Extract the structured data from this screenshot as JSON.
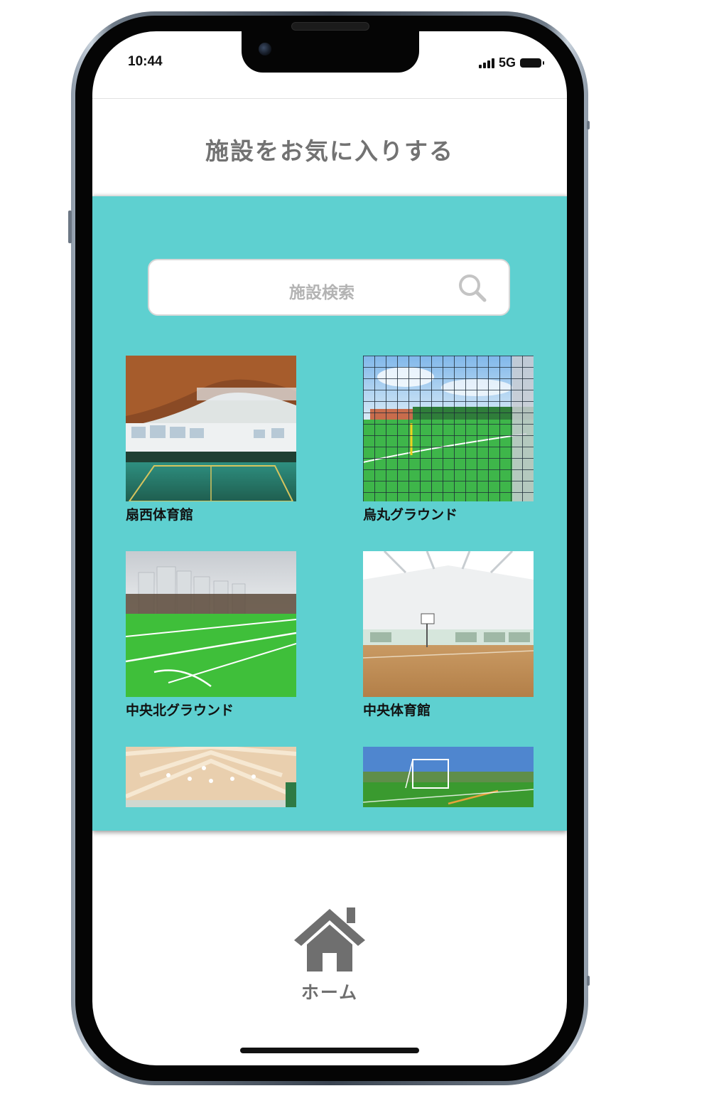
{
  "status_bar": {
    "time": "10:44",
    "network": "5G",
    "icons": [
      "signal-icon",
      "battery-icon"
    ]
  },
  "header": {
    "title": "施設をお気に入りする"
  },
  "search": {
    "placeholder": "施設検索",
    "icon": "search-icon"
  },
  "facilities": [
    {
      "name": "扇西体育館",
      "image": "indoor-gym-photo"
    },
    {
      "name": "烏丸グラウンド",
      "image": "soccer-field-net-photo"
    },
    {
      "name": "中央北グラウンド",
      "image": "soccer-field-photo"
    },
    {
      "name": "中央体育館",
      "image": "basketball-gym-photo"
    },
    {
      "name": "",
      "image": "indoor-hall-photo"
    },
    {
      "name": "",
      "image": "soccer-goal-field-photo"
    }
  ],
  "bottom_nav": {
    "home_label": "ホーム",
    "home_icon": "home-icon"
  },
  "colors": {
    "panel": "#5ed0d0",
    "title_text": "#727272",
    "placeholder_text": "#b3b3b3"
  }
}
